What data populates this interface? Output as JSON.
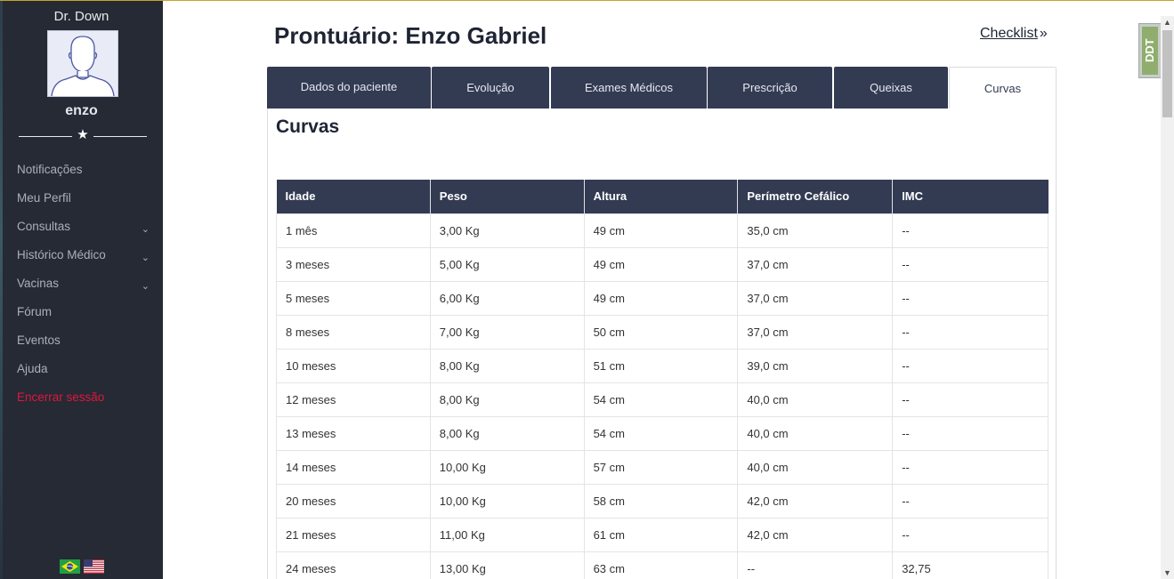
{
  "sidebar": {
    "site_name": "Dr. Down",
    "username": "enzo",
    "items": [
      {
        "label": "Notificações",
        "chevron": false
      },
      {
        "label": "Meu Perfil",
        "chevron": false
      },
      {
        "label": "Consultas",
        "chevron": true
      },
      {
        "label": "Histórico Médico",
        "chevron": true
      },
      {
        "label": "Vacinas",
        "chevron": true
      },
      {
        "label": "Fórum",
        "chevron": false
      },
      {
        "label": "Eventos",
        "chevron": false
      },
      {
        "label": "Ajuda",
        "chevron": false
      },
      {
        "label": "Encerrar sessão",
        "chevron": false,
        "color": "#e0163d"
      }
    ],
    "languages": [
      "brazil-flag-icon",
      "usa-flag-icon"
    ]
  },
  "header": {
    "title": "Prontuário: Enzo Gabriel",
    "checklist_label": "Checklist"
  },
  "tabs": [
    {
      "label": "Dados do paciente",
      "active": false
    },
    {
      "label": "Evolução",
      "active": false
    },
    {
      "label": "Exames Médicos",
      "active": false
    },
    {
      "label": "Prescrição",
      "active": false
    },
    {
      "label": "Queixas",
      "active": false
    },
    {
      "label": "Curvas",
      "active": true
    }
  ],
  "panel": {
    "title": "Curvas",
    "columns": [
      "Idade",
      "Peso",
      "Altura",
      "Perímetro Cefálico",
      "IMC"
    ],
    "rows": [
      [
        "1 mês",
        "3,00 Kg",
        "49 cm",
        "35,0 cm",
        "--"
      ],
      [
        "3 meses",
        "5,00 Kg",
        "49 cm",
        "37,0 cm",
        "--"
      ],
      [
        "5 meses",
        "6,00 Kg",
        "49 cm",
        "37,0 cm",
        "--"
      ],
      [
        "8 meses",
        "7,00 Kg",
        "50 cm",
        "37,0 cm",
        "--"
      ],
      [
        "10 meses",
        "8,00 Kg",
        "51 cm",
        "39,0 cm",
        "--"
      ],
      [
        "12 meses",
        "8,00 Kg",
        "54 cm",
        "40,0 cm",
        "--"
      ],
      [
        "13 meses",
        "8,00 Kg",
        "54 cm",
        "40,0 cm",
        "--"
      ],
      [
        "14 meses",
        "10,00 Kg",
        "57 cm",
        "40,0 cm",
        "--"
      ],
      [
        "20 meses",
        "10,00 Kg",
        "58 cm",
        "42,0 cm",
        "--"
      ],
      [
        "21 meses",
        "11,00 Kg",
        "61 cm",
        "42,0 cm",
        "--"
      ],
      [
        "24 meses",
        "13,00 Kg",
        "63 cm",
        "--",
        "32,75"
      ]
    ]
  },
  "badge": {
    "text": "DDT"
  },
  "colors": {
    "sidebar_bg": "#252a34",
    "accent_navy": "#333b53",
    "logout_red": "#e0163d"
  }
}
